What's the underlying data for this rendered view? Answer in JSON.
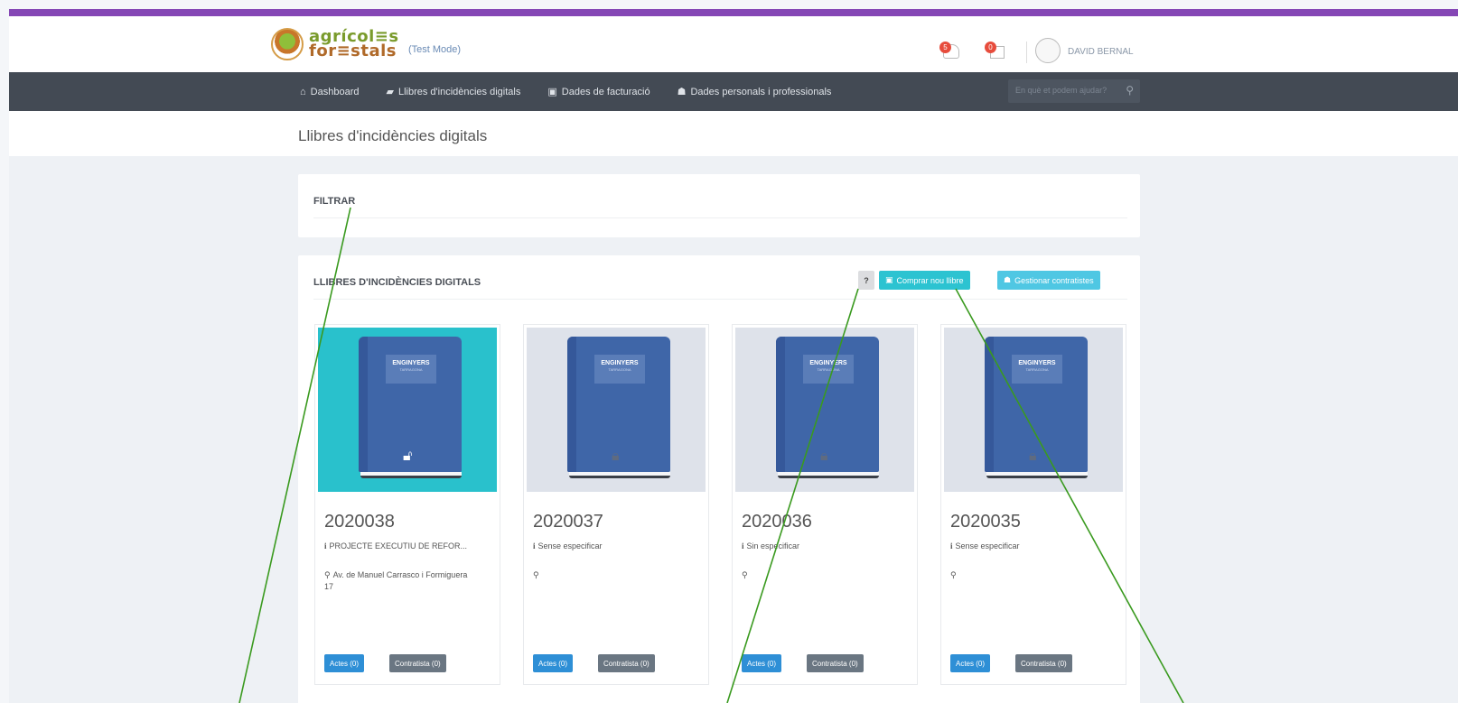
{
  "header": {
    "test_mode": "(Test Mode)",
    "notifications": [
      {
        "icon": "bell-icon",
        "badge": "5"
      },
      {
        "icon": "calendar-icon",
        "badge": "0"
      }
    ],
    "user_name": "DAVID BERNAL"
  },
  "nav": {
    "items": [
      {
        "icon": "home-icon",
        "label": "Dashboard"
      },
      {
        "icon": "book-icon",
        "label": "Llibres d'incidències digitals"
      },
      {
        "icon": "money-icon",
        "label": "Dades de facturació"
      },
      {
        "icon": "users-icon",
        "label": "Dades personals i professionals"
      }
    ],
    "search_placeholder": "En què et podem ajudar?"
  },
  "page": {
    "title": "Llibres d'incidències digitals"
  },
  "filter_panel": {
    "title": "FILTRAR"
  },
  "books_panel": {
    "title": "LLIBRES D'INCIDÈNCIES DIGITALS",
    "help_label": "?",
    "buy_label": "Comprar nou llibre",
    "manage_label": "Gestionar contratistes"
  },
  "books": [
    {
      "number": "2020038",
      "description": "PROJECTE EXECUTIU DE REFOR...",
      "address": "Av. de Manuel Carrasco i Formiguera 17",
      "cover_brand": "ENGINYERS",
      "cover_sub": "TARRAGONA",
      "actes_label": "Actes (0)",
      "contratista_label": "Contratista (0)",
      "active": true
    },
    {
      "number": "2020037",
      "description": "Sense especificar",
      "address": "",
      "cover_brand": "ENGINYERS",
      "cover_sub": "TARRAGONA",
      "actes_label": "Actes (0)",
      "contratista_label": "Contratista (0)",
      "active": false
    },
    {
      "number": "2020036",
      "description": "Sin especificar",
      "address": "",
      "cover_brand": "ENGINYERS",
      "cover_sub": "TARRAGONA",
      "actes_label": "Actes (0)",
      "contratista_label": "Contratista (0)",
      "active": false
    },
    {
      "number": "2020035",
      "description": "Sense especificar",
      "address": "",
      "cover_brand": "ENGINYERS",
      "cover_sub": "TARRAGONA",
      "actes_label": "Actes (0)",
      "contratista_label": "Contratista (0)",
      "active": false
    }
  ],
  "colors": {
    "accent_bar": "#8547b5",
    "navbar": "#434a54",
    "primary_teal": "#2cc3d1",
    "book_blue": "#3f66a8",
    "annotation_line": "#3a9a1f"
  }
}
